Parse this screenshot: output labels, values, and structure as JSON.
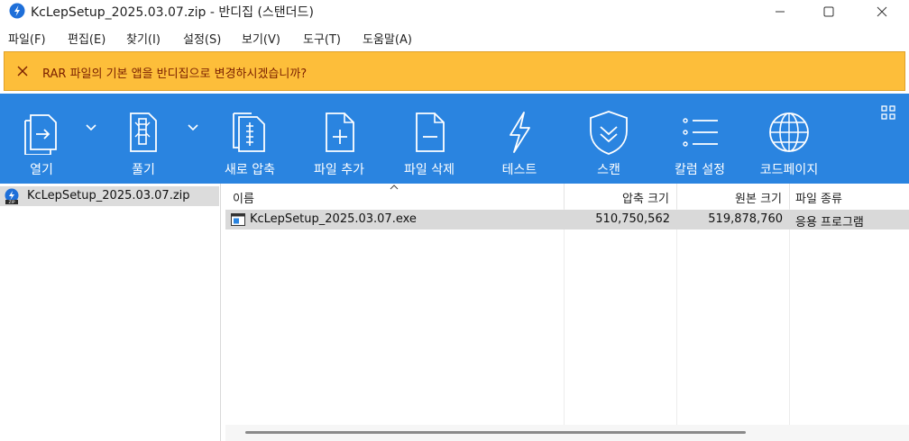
{
  "window": {
    "title": "KcLepSetup_2025.03.07.zip - 반디집 (스탠더드)"
  },
  "menu": [
    {
      "label": "파일(F)"
    },
    {
      "label": "편집(E)"
    },
    {
      "label": "찾기(I)"
    },
    {
      "label": "설정(S)"
    },
    {
      "label": "보기(V)"
    },
    {
      "label": "도구(T)"
    },
    {
      "label": "도움말(A)"
    }
  ],
  "notification": {
    "text": "RAR 파일의 기본 앱을 반디집으로 변경하시겠습니까?",
    "background": "#fdbe3a"
  },
  "toolbar": {
    "background": "#2a84e0",
    "items": [
      {
        "label": "열기",
        "icon": "open-archive-icon"
      },
      {
        "label": "풀기",
        "icon": "extract-icon"
      },
      {
        "label": "새로 압축",
        "icon": "new-archive-icon"
      },
      {
        "label": "파일 추가",
        "icon": "add-file-icon"
      },
      {
        "label": "파일 삭제",
        "icon": "delete-file-icon"
      },
      {
        "label": "테스트",
        "icon": "lightning-icon"
      },
      {
        "label": "스캔",
        "icon": "shield-scan-icon"
      },
      {
        "label": "칼럼 설정",
        "icon": "column-list-icon"
      },
      {
        "label": "코드페이지",
        "icon": "globe-icon"
      }
    ]
  },
  "tree": {
    "items": [
      {
        "label": "KcLepSetup_2025.03.07.zip",
        "icon": "zip-archive-icon"
      }
    ]
  },
  "filelist": {
    "columns": {
      "name": "이름",
      "packed": "압축 크기",
      "original": "원본 크기",
      "type": "파일 종류"
    },
    "rows": [
      {
        "name": "KcLepSetup_2025.03.07.exe",
        "packed": "510,750,562",
        "original": "519,878,760",
        "type": "응용 프로그램",
        "icon": "exe-file-icon"
      }
    ]
  }
}
